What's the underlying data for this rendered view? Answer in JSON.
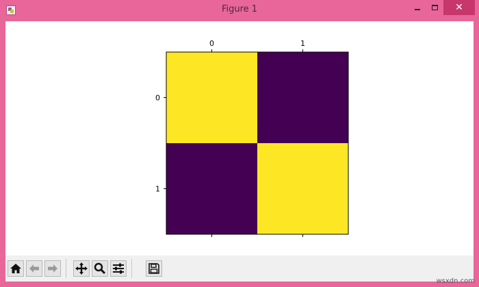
{
  "window": {
    "title": "Figure 1",
    "controls": {
      "minimize": "",
      "maximize": "",
      "close": "✕"
    }
  },
  "chart_data": {
    "type": "heatmap",
    "x_tick_labels": [
      "0",
      "1"
    ],
    "y_tick_labels": [
      "0",
      "1"
    ],
    "x_tick_position": "top",
    "values": [
      [
        1,
        0
      ],
      [
        0,
        1
      ]
    ],
    "colormap": {
      "low": "#440154",
      "high": "#fde725"
    },
    "grid": false
  },
  "toolbar": {
    "tools": [
      {
        "id": "home",
        "icon": "home-icon"
      },
      {
        "id": "back",
        "icon": "back-arrow-icon"
      },
      {
        "id": "forward",
        "icon": "forward-arrow-icon"
      },
      {
        "id": "pan",
        "icon": "pan-move-icon"
      },
      {
        "id": "zoom",
        "icon": "zoom-icon"
      },
      {
        "id": "configure",
        "icon": "configure-subplots-icon"
      },
      {
        "id": "save",
        "icon": "save-icon"
      }
    ]
  },
  "watermark": "wsxdn.com"
}
